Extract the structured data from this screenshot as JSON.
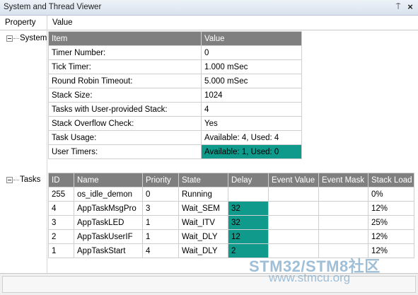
{
  "window": {
    "title": "System and Thread Viewer",
    "pin_glyph": "⍑",
    "close_glyph": "×"
  },
  "columns": {
    "property": "Property",
    "value": "Value"
  },
  "tree": {
    "system_label": "System",
    "tasks_label": "Tasks"
  },
  "system_table": {
    "headers": {
      "item": "Item",
      "value": "Value"
    },
    "rows": [
      {
        "item": "Timer Number:",
        "value": "0"
      },
      {
        "item": "Tick Timer:",
        "value": "1.000 mSec"
      },
      {
        "item": "Round Robin Timeout:",
        "value": "5.000 mSec"
      },
      {
        "item": "Stack Size:",
        "value": "1024"
      },
      {
        "item": "Tasks with User-provided Stack:",
        "value": "4"
      },
      {
        "item": "Stack Overflow Check:",
        "value": "Yes"
      },
      {
        "item": "Task Usage:",
        "value": "Available: 4, Used: 4"
      },
      {
        "item": "User Timers:",
        "value": "Available: 1, Used: 0"
      }
    ]
  },
  "tasks_table": {
    "headers": {
      "id": "ID",
      "name": "Name",
      "priority": "Priority",
      "state": "State",
      "delay": "Delay",
      "event_value": "Event Value",
      "event_mask": "Event Mask",
      "stack_load": "Stack Load"
    },
    "rows": [
      {
        "id": "255",
        "name": "os_idle_demon",
        "priority": "0",
        "state": "Running",
        "delay": "",
        "event_value": "",
        "event_mask": "",
        "stack_load": "0%"
      },
      {
        "id": "4",
        "name": "AppTaskMsgPro",
        "priority": "3",
        "state": "Wait_SEM",
        "delay": "32",
        "event_value": "",
        "event_mask": "",
        "stack_load": "12%"
      },
      {
        "id": "3",
        "name": "AppTaskLED",
        "priority": "1",
        "state": "Wait_ITV",
        "delay": "32",
        "event_value": "",
        "event_mask": "",
        "stack_load": "25%"
      },
      {
        "id": "2",
        "name": "AppTaskUserIF",
        "priority": "1",
        "state": "Wait_DLY",
        "delay": "12",
        "event_value": "",
        "event_mask": "",
        "stack_load": "12%"
      },
      {
        "id": "1",
        "name": "AppTaskStart",
        "priority": "4",
        "state": "Wait_DLY",
        "delay": "2",
        "event_value": "",
        "event_mask": "",
        "stack_load": "12%"
      }
    ]
  },
  "watermark": {
    "line1": "STM32/STM8社区",
    "line2": "www.stmcu.org"
  },
  "colors": {
    "highlight": "#0f9a8c",
    "header_bg": "#7f7f7f"
  }
}
